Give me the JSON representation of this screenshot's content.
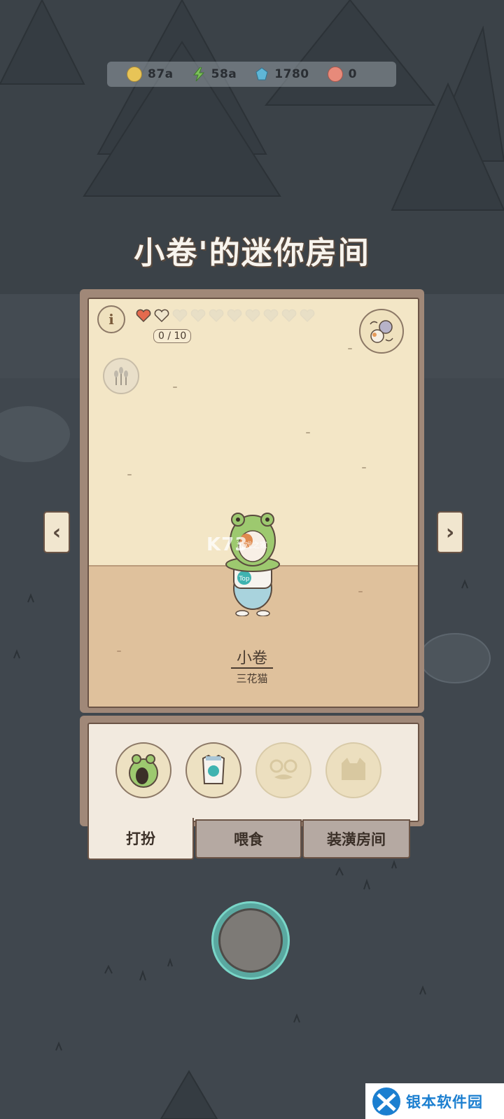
{
  "resources": [
    {
      "icon": "coin-icon",
      "value": "87a",
      "color": "#e8c457"
    },
    {
      "icon": "energy-icon",
      "value": "58a",
      "color": "#7cc05a"
    },
    {
      "icon": "gem-icon",
      "value": "1780",
      "color": "#5fb6d6"
    },
    {
      "icon": "fish-token-icon",
      "value": "0",
      "color": "#e78a7a"
    }
  ],
  "room_title": "小卷'的迷你房间",
  "room": {
    "info_label": "i",
    "hearts_total": 10,
    "hearts_filled": 1,
    "affinity_text": "0 / 10",
    "cat_name": "小卷",
    "cat_breed": "三花猫",
    "arrow_left": "‹",
    "arrow_right": "›",
    "watermark_main": "K73",
    "watermark_sub": "游戏之家"
  },
  "outfit_slots": [
    {
      "name": "frog-hat",
      "equipped": true
    },
    {
      "name": "top-shirt",
      "equipped": true
    },
    {
      "name": "glasses-mustache",
      "equipped": false
    },
    {
      "name": "cat-face",
      "equipped": false
    }
  ],
  "tabs": [
    {
      "label": "打扮",
      "active": true
    },
    {
      "label": "喂食",
      "active": false
    },
    {
      "label": "装潢房间",
      "active": false
    }
  ],
  "shirt_label": "Top",
  "site_watermark": "银本软件园"
}
